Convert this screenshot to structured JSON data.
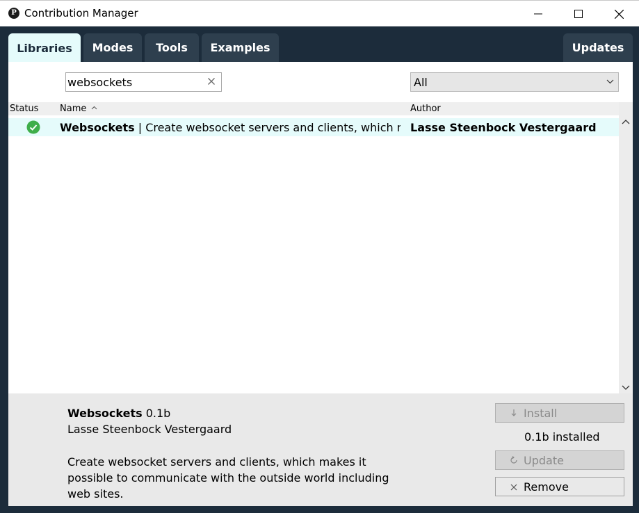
{
  "window": {
    "title": "Contribution Manager",
    "app_icon_glyph": "P"
  },
  "tabs": [
    {
      "label": "Libraries",
      "active": true
    },
    {
      "label": "Modes",
      "active": false
    },
    {
      "label": "Tools",
      "active": false
    },
    {
      "label": "Examples",
      "active": false
    }
  ],
  "updates_tab": {
    "label": "Updates"
  },
  "search": {
    "value": "websockets",
    "placeholder": ""
  },
  "category_filter": {
    "selected": "All"
  },
  "table": {
    "headers": {
      "status": "Status",
      "name": "Name",
      "author": "Author"
    },
    "rows": [
      {
        "status": "installed",
        "name": "Websockets",
        "separator": " | ",
        "summary": "Create websocket servers and clients, which mak…",
        "author": "Lasse Steenbock Vestergaard"
      }
    ]
  },
  "details": {
    "name": "Websockets",
    "version": "0.1b",
    "author": "Lasse Steenbock Vestergaard",
    "description": "Create websocket servers and clients, which makes it possible to communicate with the outside world including web sites.",
    "installed_text": "0.1b installed",
    "install_label": "Install",
    "update_label": "Update",
    "remove_label": "Remove"
  },
  "colors": {
    "frame": "#1c2c3b",
    "tab": "#2e3f4e",
    "active_tab": "#e5fbfb",
    "selected_row": "#e5fbfb",
    "status_green": "#3fae4a"
  }
}
